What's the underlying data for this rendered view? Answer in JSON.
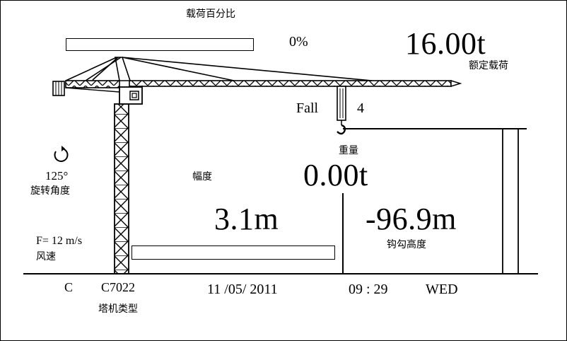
{
  "load": {
    "percent_label": "载荷百分比",
    "percent_value": "0%",
    "percent_fraction": 0.0,
    "rated_value": "16.00t",
    "rated_label": "额定载荷"
  },
  "fall": {
    "label": "Fall",
    "value": "4"
  },
  "weight": {
    "label": "重量",
    "value": "0.00t"
  },
  "radius": {
    "label": "幅度",
    "value": "3.1m",
    "bar_fraction": 0.0
  },
  "hook_height": {
    "label": "钩勾高度",
    "value": "-96.9m"
  },
  "slew": {
    "value": "125°",
    "label": "旋转角度",
    "icon": "rotate-icon"
  },
  "wind": {
    "value": "F= 12 m/s",
    "label": "风速"
  },
  "crane_model": {
    "class": "C",
    "model": "C7022",
    "label": "塔机类型"
  },
  "status": {
    "date": "11 /05/ 2011",
    "time": "09 : 29",
    "weekday": "WED"
  }
}
